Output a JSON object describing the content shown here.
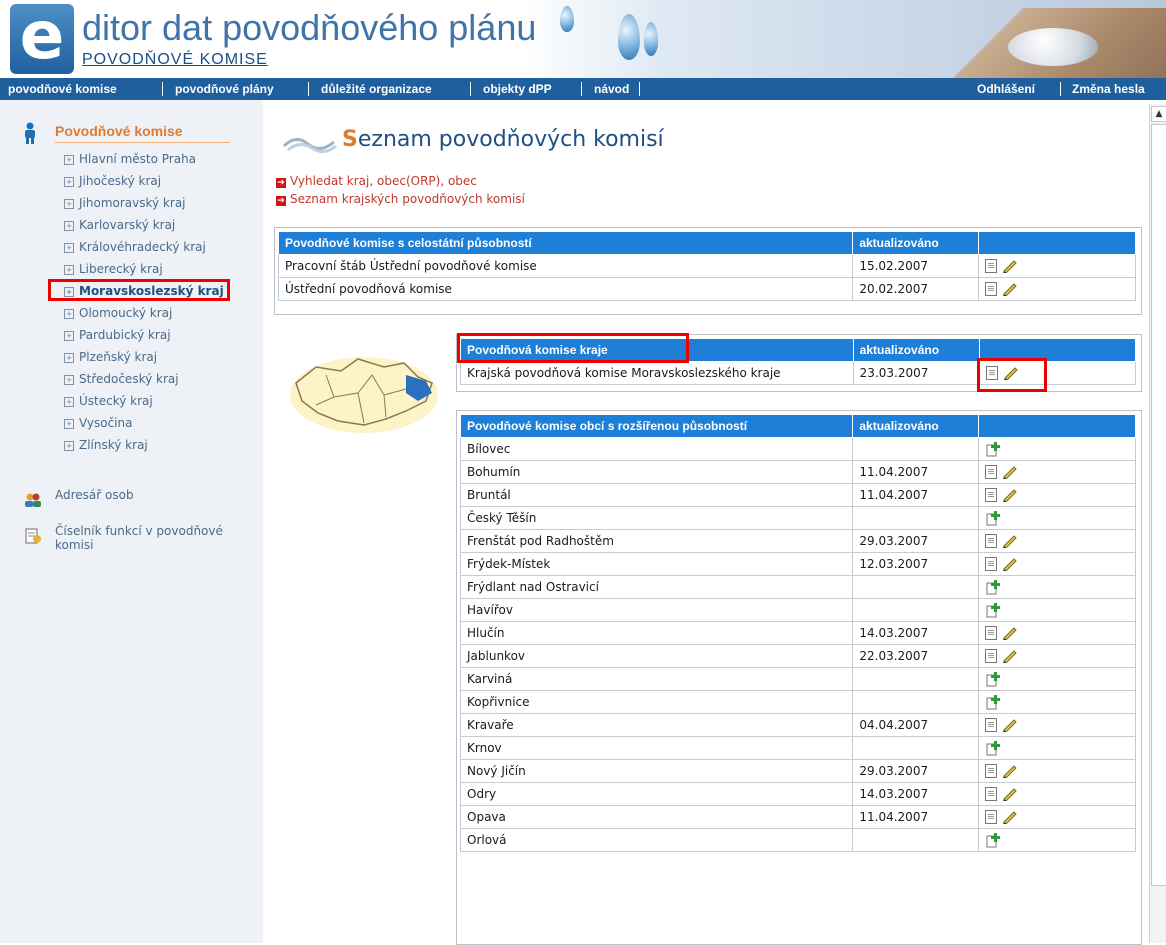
{
  "banner": {
    "logo_letter": "e",
    "title": "ditor dat povodňového plánu",
    "subtitle": "POVODŇOVÉ KOMISE"
  },
  "topnav": {
    "items": [
      "povodňové komise",
      "povodňové plány",
      "důležité organizace",
      "objekty dPP",
      "návod"
    ],
    "right": [
      "Odhlášení",
      "Změna hesla"
    ]
  },
  "sidebar": {
    "title": "Povodňové komise",
    "items": [
      "Hlavní město Praha",
      "Jihočeský kraj",
      "Jihomoravský kraj",
      "Karlovarský kraj",
      "Královéhradecký kraj",
      "Liberecký kraj",
      "Moravskoslezský kraj",
      "Olomoucký kraj",
      "Pardubický kraj",
      "Plzeňský kraj",
      "Středočeský kraj",
      "Ústecký kraj",
      "Vysočina",
      "Zlínský kraj"
    ],
    "active_index": 6,
    "links": [
      "Adresář osob",
      "Číselník funkcí v povodňové komisi"
    ]
  },
  "main": {
    "title_first": "S",
    "title_rest": "eznam povodňových komisí",
    "links": [
      "Vyhledat kraj, obec(ORP), obec",
      "Seznam krajských povodňových komisí"
    ],
    "national": {
      "header": "Povodňové komise s celostátní působností",
      "updated_header": "aktualizováno",
      "rows": [
        {
          "name": "Pracovní štáb Ústřední povodňové komise",
          "date": "15.02.2007"
        },
        {
          "name": "Ústřední povodňová komise",
          "date": "20.02.2007"
        }
      ]
    },
    "region": {
      "header": "Povodňová komise kraje",
      "updated_header": "aktualizováno",
      "rows": [
        {
          "name": "Krajská povodňová komise Moravskoslezského kraje",
          "date": "23.03.2007"
        }
      ]
    },
    "municipal": {
      "header": "Povodňové komise obcí s rozšířenou působností",
      "updated_header": "aktualizováno",
      "rows": [
        {
          "name": "Bílovec",
          "date": ""
        },
        {
          "name": "Bohumín",
          "date": "11.04.2007"
        },
        {
          "name": "Bruntál",
          "date": "11.04.2007"
        },
        {
          "name": "Český Těšín",
          "date": ""
        },
        {
          "name": "Frenštát pod Radhoštěm",
          "date": "29.03.2007"
        },
        {
          "name": "Frýdek-Místek",
          "date": "12.03.2007"
        },
        {
          "name": "Frýdlant nad Ostravicí",
          "date": ""
        },
        {
          "name": "Havířov",
          "date": ""
        },
        {
          "name": "Hlučín",
          "date": "14.03.2007"
        },
        {
          "name": "Jablunkov",
          "date": "22.03.2007"
        },
        {
          "name": "Karviná",
          "date": ""
        },
        {
          "name": "Kopřivnice",
          "date": ""
        },
        {
          "name": "Kravaře",
          "date": "04.04.2007"
        },
        {
          "name": "Krnov",
          "date": ""
        },
        {
          "name": "Nový Jičín",
          "date": "29.03.2007"
        },
        {
          "name": "Odry",
          "date": "14.03.2007"
        },
        {
          "name": "Opava",
          "date": "11.04.2007"
        },
        {
          "name": "Orlová",
          "date": ""
        }
      ]
    }
  }
}
